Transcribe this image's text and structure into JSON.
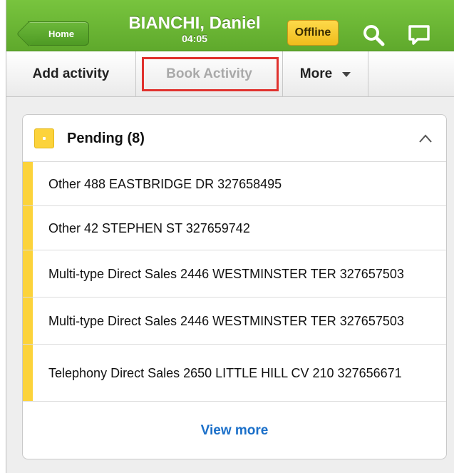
{
  "header": {
    "home_label": "Home",
    "name": "BIANCHI, Daniel",
    "time": "04:05",
    "status_badge": "Offline",
    "search_icon": "search-icon",
    "chat_icon": "chat-icon",
    "colors": {
      "header_green": "#6ab836",
      "badge_yellow": "#f7c935"
    }
  },
  "toolbar": {
    "add_activity": "Add activity",
    "book_activity": "Book Activity",
    "more": "More",
    "highlight_color": "#e0322e"
  },
  "pending": {
    "title": "Pending (8)",
    "items": [
      {
        "text": "Other 488 EASTBRIDGE DR 327658495"
      },
      {
        "text": "Other 42 STEPHEN ST 327659742"
      },
      {
        "text": "Multi-type Direct Sales 2446 WESTMINSTER TER 327657503"
      },
      {
        "text": "Multi-type Direct Sales 2446 WESTMINSTER TER 327657503"
      },
      {
        "text": "Telephony Direct Sales 2650 LITTLE HILL CV 210 327656671"
      }
    ],
    "view_more": "View more",
    "status_color": "#fcd33b"
  }
}
